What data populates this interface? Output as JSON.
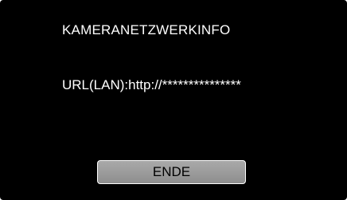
{
  "dialog": {
    "title": "KAMERANETZWERKINFO",
    "url_text": "URL(LAN):http://***************",
    "end_button_label": "ENDE"
  },
  "colors": {
    "background": "#000000",
    "text": "#ffffff",
    "button_fill": "#9a9a9a",
    "button_text": "#000000"
  }
}
